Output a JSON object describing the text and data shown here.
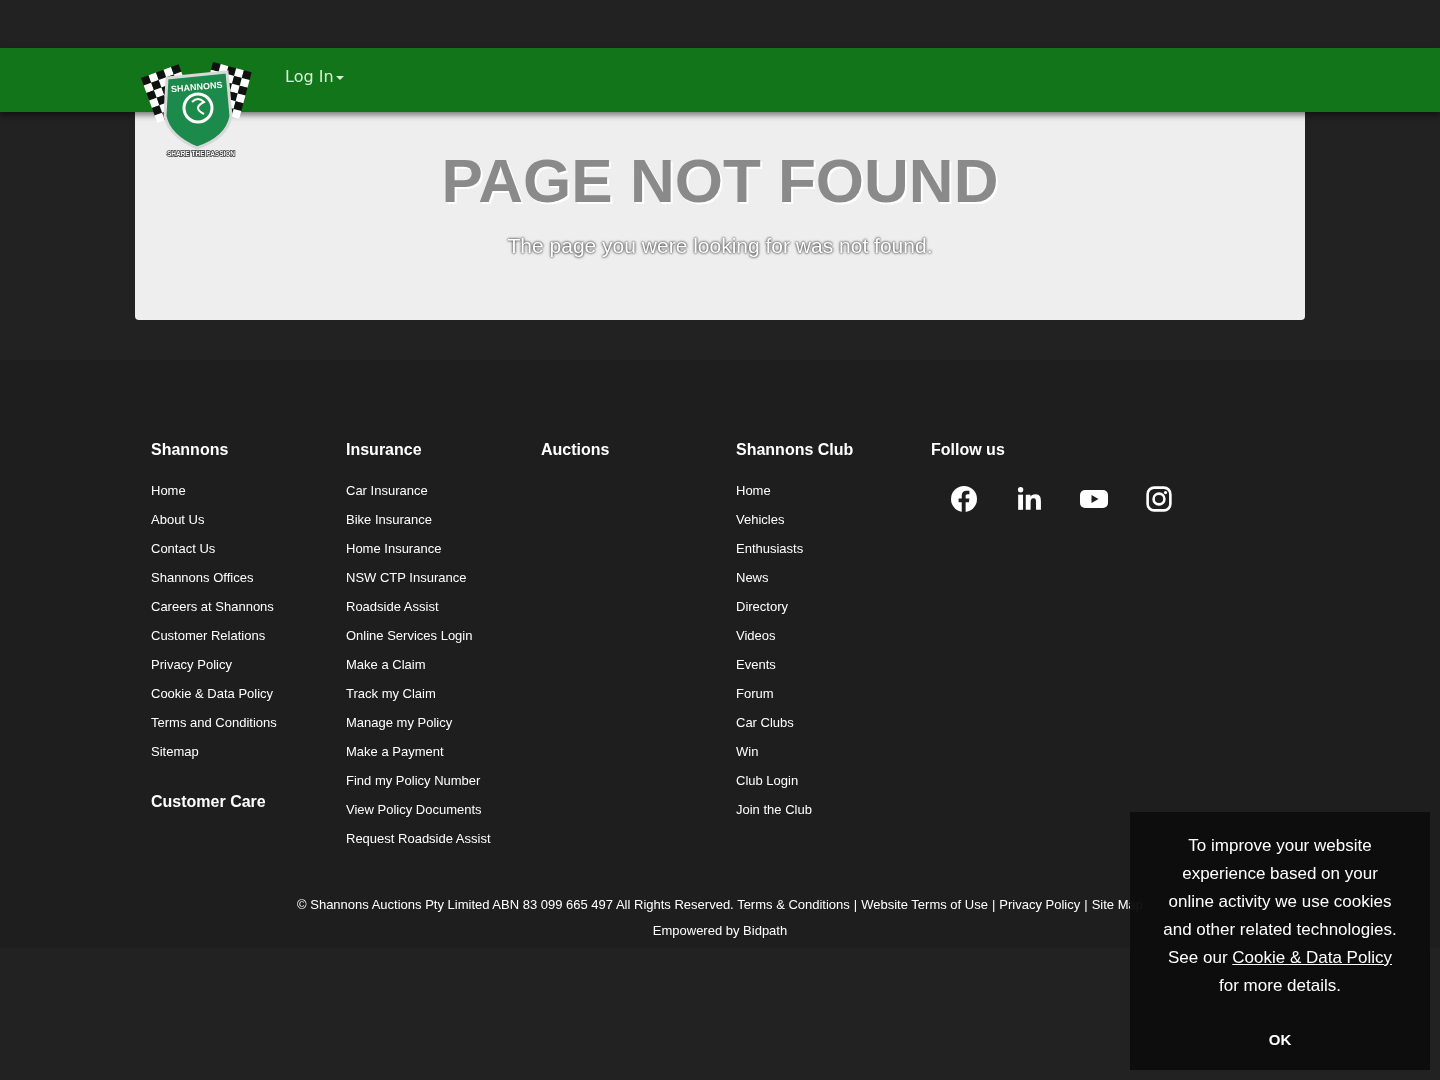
{
  "logo": {
    "badge_text": "SHANNONS",
    "tagline": "SHARE THE PASSION"
  },
  "nav": {
    "login": "Log In"
  },
  "error": {
    "title": "PAGE NOT FOUND",
    "message": "The page you were looking for was not found."
  },
  "footer_columns": [
    {
      "heading": "Shannons",
      "links": [
        "Home",
        "About Us",
        "Contact Us",
        "Shannons Offices",
        "Careers at Shannons",
        "Customer Relations",
        "Privacy Policy",
        "Cookie & Data Policy",
        "Terms and Conditions",
        "Sitemap"
      ],
      "subheading": "Customer Care"
    },
    {
      "heading": "Insurance",
      "links": [
        "Car Insurance",
        "Bike Insurance",
        "Home Insurance",
        "NSW CTP Insurance",
        "Roadside Assist",
        "Online Services Login",
        "Make a Claim",
        "Track my Claim",
        "Manage my Policy",
        "Make a Payment",
        "Find my Policy Number",
        "View Policy Documents",
        "Request Roadside Assist"
      ]
    },
    {
      "heading": "Auctions"
    },
    {
      "heading": "Shannons Club",
      "links": [
        "Home",
        "Vehicles",
        "Enthusiasts",
        "News",
        "Directory",
        "Videos",
        "Events",
        "Forum",
        "Car Clubs",
        "Win",
        "Club Login",
        "Join the Club"
      ]
    }
  ],
  "follow": {
    "heading": "Follow us",
    "icons": [
      {
        "kind": "facebook"
      },
      {
        "kind": "linkedin"
      },
      {
        "kind": "youtube"
      },
      {
        "kind": "instagram"
      }
    ]
  },
  "copyright": "© Shannons Auctions Pty Limited ABN 83 099 665 497 All Rights Reserved.",
  "legal_links": [
    "Terms & Conditions",
    "Website Terms of Use",
    "Privacy Policy",
    "Site Map"
  ],
  "legal_separator": "|",
  "powered_by": "Empowered by Bidpath",
  "cookie_banner": {
    "text_before": "To improve your website experience based on your online activity we use cookies and other related technologies. See our",
    "link": "Cookie & Data Policy",
    "text_after": "for more details.",
    "button": "OK"
  }
}
